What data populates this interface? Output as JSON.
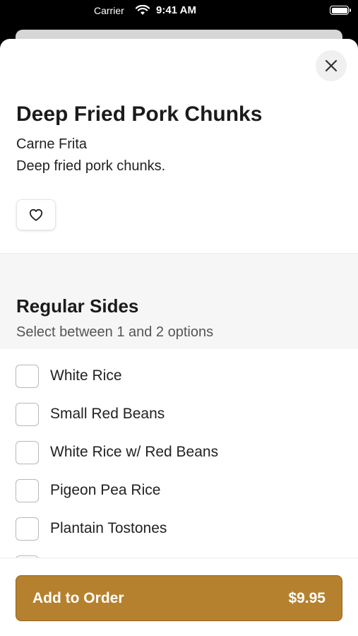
{
  "status_bar": {
    "carrier": "Carrier",
    "time": "9:41 AM"
  },
  "item": {
    "title": "Deep Fried Pork Chunks",
    "subtitle": "Carne Frita",
    "description": "Deep fried pork chunks."
  },
  "icons": {
    "close": "close-icon",
    "favorite": "heart-icon",
    "wifi": "wifi-icon",
    "battery": "battery-icon"
  },
  "sides": {
    "title": "Regular Sides",
    "subtitle": "Select between 1 and 2 options",
    "options": [
      {
        "label": "White Rice",
        "checked": false
      },
      {
        "label": "Small Red Beans",
        "checked": false
      },
      {
        "label": "White Rice w/ Red Beans",
        "checked": false
      },
      {
        "label": "Pigeon Pea Rice",
        "checked": false
      },
      {
        "label": "Plantain Tostones",
        "checked": false
      }
    ]
  },
  "order": {
    "button_label": "Add to Order",
    "price": "$9.95"
  },
  "colors": {
    "accent": "#b5812e",
    "sheet_background": "#ffffff",
    "section_background": "#f6f6f6"
  }
}
